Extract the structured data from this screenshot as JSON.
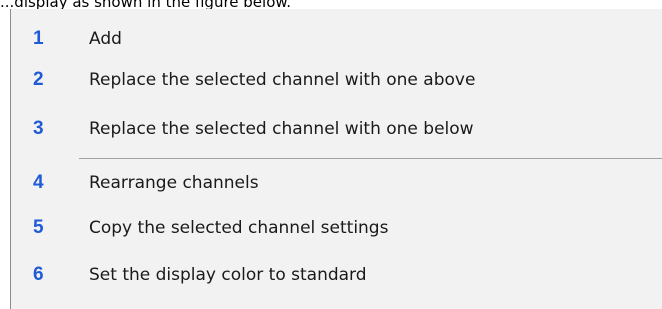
{
  "caption": "...display as shown in the figure below.",
  "menu": {
    "items": [
      {
        "number": "1",
        "label": "Add"
      },
      {
        "number": "2",
        "label": "Replace the selected channel with one above"
      },
      {
        "number": "3",
        "label": "Replace the selected channel with one below"
      },
      {
        "number": "4",
        "label": "Rearrange channels"
      },
      {
        "number": "5",
        "label": "Copy the selected channel settings"
      },
      {
        "number": "6",
        "label": "Set the display color to standard"
      }
    ]
  },
  "colors": {
    "menu_background": "#f2f2f2",
    "number_color": "#1f5bd6",
    "text_color": "#1a1a1a",
    "separator_color": "#a0a0a0"
  }
}
